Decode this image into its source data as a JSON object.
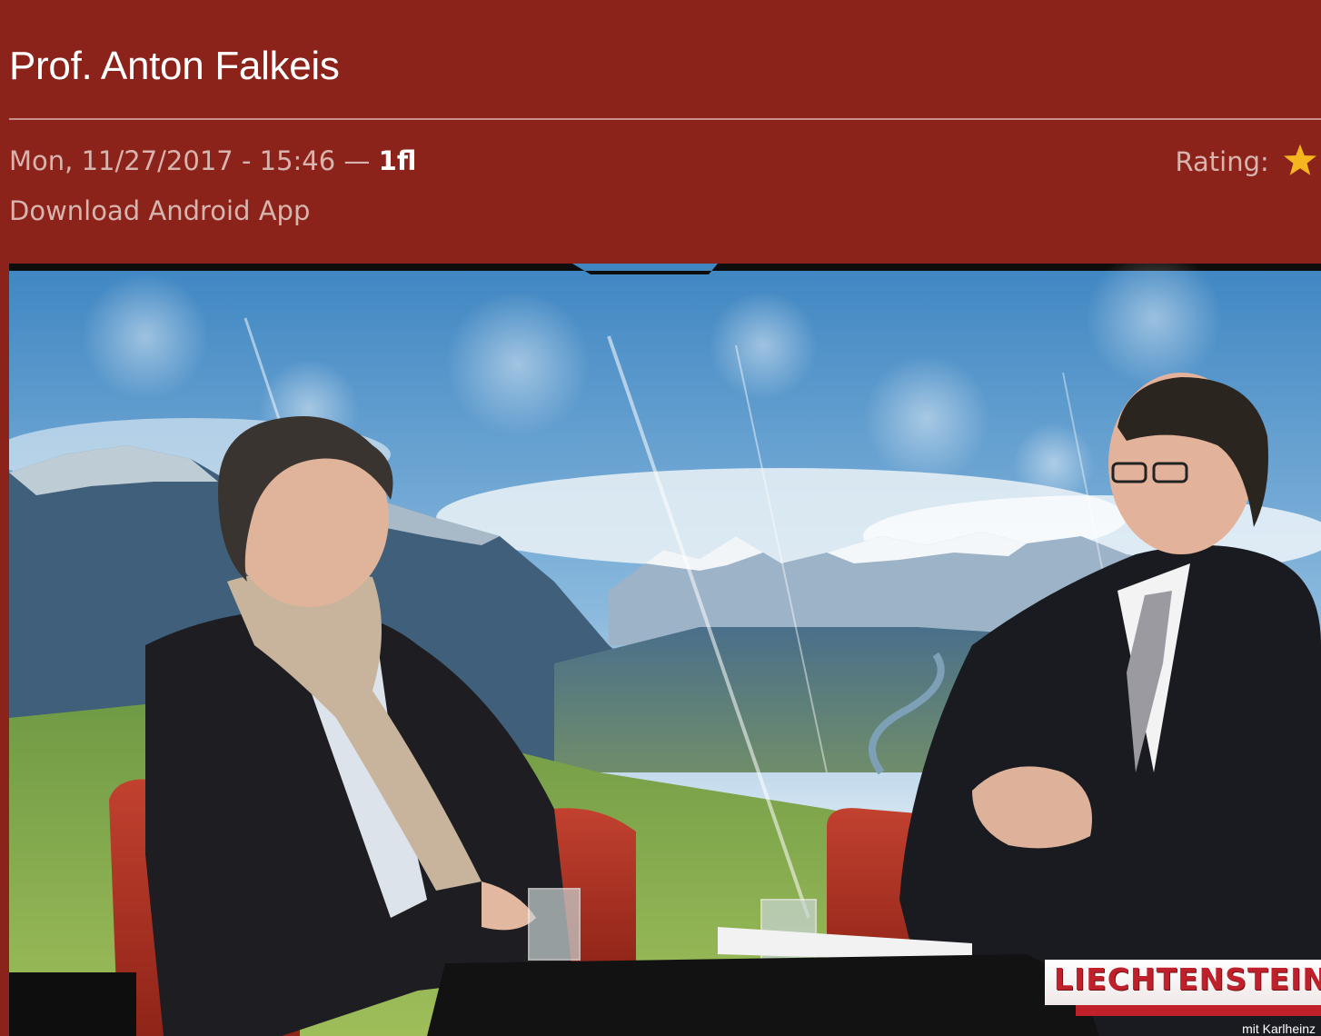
{
  "post": {
    "title": "Prof. Anton Falkeis",
    "date": "Mon, 11/27/2017 - 15:46",
    "separator": " — ",
    "author": "1fl",
    "rating_label": "Rating:",
    "download_link": "Download Android App"
  },
  "video": {
    "logo_text": "LIECHTENSTEIN",
    "logo_subtitle": "mit Karlheinz"
  },
  "colors": {
    "background": "#8b231b",
    "title_text": "#ffffff",
    "meta_text": "#d8b4ae",
    "star": "#f5b51e"
  }
}
